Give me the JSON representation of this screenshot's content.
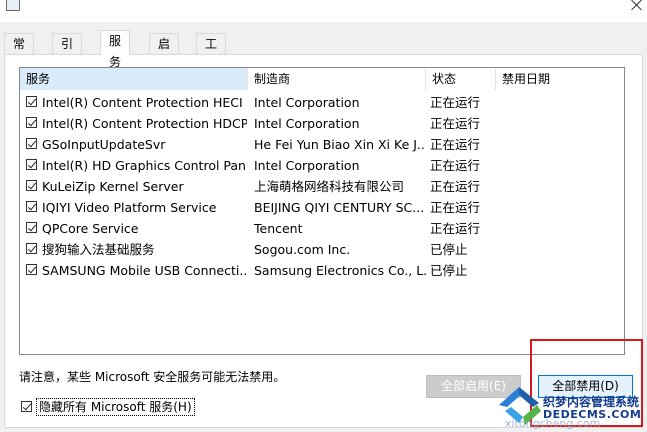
{
  "tabs": [
    "常规",
    "引导",
    "服务",
    "启动",
    "工具"
  ],
  "active_tab": "服务",
  "columns": [
    "服务",
    "制造商",
    "状态",
    "禁用日期"
  ],
  "services": [
    {
      "name": "Intel(R) Content Protection HECI ...",
      "vendor": "Intel Corporation",
      "status": "正在运行",
      "date": "",
      "checked": true
    },
    {
      "name": "Intel(R) Content Protection HDCP...",
      "vendor": "Intel Corporation",
      "status": "正在运行",
      "date": "",
      "checked": true
    },
    {
      "name": "GSoInputUpdateSvr",
      "vendor": "He Fei Yun Biao Xin Xi Ke J...",
      "status": "正在运行",
      "date": "",
      "checked": true
    },
    {
      "name": "Intel(R) HD Graphics Control Pan...",
      "vendor": "Intel Corporation",
      "status": "正在运行",
      "date": "",
      "checked": true
    },
    {
      "name": "KuLeiZip Kernel Server",
      "vendor": "上海萌格网络科技有限公司",
      "status": "正在运行",
      "date": "",
      "checked": true
    },
    {
      "name": "IQIYI Video Platform Service",
      "vendor": "BEIJING QIYI CENTURY SC...",
      "status": "正在运行",
      "date": "",
      "checked": true
    },
    {
      "name": "QPCore Service",
      "vendor": "Tencent",
      "status": "正在运行",
      "date": "",
      "checked": true
    },
    {
      "name": "搜狗输入法基础服务",
      "vendor": "Sogou.com Inc.",
      "status": "已停止",
      "date": "",
      "checked": true
    },
    {
      "name": "SAMSUNG Mobile USB Connecti...",
      "vendor": "Samsung Electronics Co., L...",
      "status": "已停止",
      "date": "",
      "checked": true
    }
  ],
  "note": "请注意，某些 Microsoft 安全服务可能无法禁用。",
  "hide_ms_label": "隐藏所有 Microsoft 服务(H)",
  "hide_ms_checked": true,
  "enable_all_label": "全部启用(E)",
  "disable_all_label": "全部禁用(D)",
  "watermark": {
    "title": "织梦内容管理系统",
    "url": "DEDECMS.COM",
    "faint": "xitongcheng.com"
  },
  "colors": {
    "highlight_border": "#d7191c",
    "header_sorted": "#d9ebf9"
  }
}
